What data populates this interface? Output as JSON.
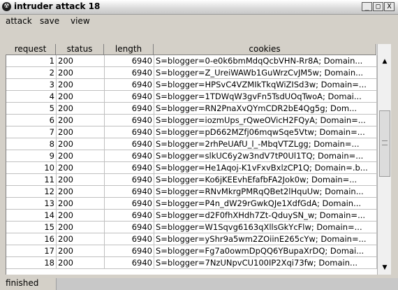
{
  "window": {
    "title": "intruder attack 18",
    "minimize": "_",
    "maximize": "□",
    "close": "X"
  },
  "menu": [
    "attack",
    "save",
    "view"
  ],
  "table": {
    "columns": [
      "request",
      "status",
      "length",
      "cookies"
    ],
    "rows": [
      [
        "1",
        "200",
        "6940",
        "S=blogger=0-e0k6bmMdqQcbVHN-Rr8A; Domain..."
      ],
      [
        "2",
        "200",
        "6940",
        "S=blogger=Z_UreiWAWb1GuWrzCvJM5w; Domain..."
      ],
      [
        "3",
        "200",
        "6940",
        "S=blogger=HPSvC4VZMIkTkqWiZISd3w; Domain=..."
      ],
      [
        "4",
        "200",
        "6940",
        "S=blogger=1TDWqW3gvFn5TsdUOqTwoA; Domai..."
      ],
      [
        "5",
        "200",
        "6940",
        "S=blogger=RN2PnaXvQYmCDR2bE4Qg5g; Dom..."
      ],
      [
        "6",
        "200",
        "6940",
        "S=blogger=iozmUps_rQweOVicH2FQyA; Domain=..."
      ],
      [
        "7",
        "200",
        "6940",
        "S=blogger=pD662MZfj06mqwSqe5Vtw; Domain=..."
      ],
      [
        "8",
        "200",
        "6940",
        "S=blogger=2rhPeUAfU_l_-MbqVTZLgg; Domain=..."
      ],
      [
        "9",
        "200",
        "6940",
        "S=blogger=slkUC6y2w3ndV7tP0Ul1TQ; Domain=..."
      ],
      [
        "10",
        "200",
        "6940",
        "S=blogger=He1Aqoj-K1vFxvBxlzCP1Q; Domain=.b..."
      ],
      [
        "11",
        "200",
        "6940",
        "S=blogger=Ko6jKEEvhEfafbFA2Jok0w; Domain=..."
      ],
      [
        "12",
        "200",
        "6940",
        "S=blogger=RNvMkrgPMRqQBet2lHquUw; Domain..."
      ],
      [
        "13",
        "200",
        "6940",
        "S=blogger=P4n_dW29rGwkQJe1XdfGdA; Domain..."
      ],
      [
        "14",
        "200",
        "6940",
        "S=blogger=d2F0fhXHdh7Zt-QduySN_w; Domain=..."
      ],
      [
        "15",
        "200",
        "6940",
        "S=blogger=W1Sqvg6163qXllsGkYcFlw; Domain=..."
      ],
      [
        "16",
        "200",
        "6940",
        "S=blogger=yShr9a5wm2ZOiinE265cYw; Domain=..."
      ],
      [
        "17",
        "200",
        "6940",
        "S=blogger=Fg7a0owmDpQQ6YBupaXrDQ; Domai..."
      ],
      [
        "18",
        "200",
        "6940",
        "S=blogger=7NzUNpvCU100IP2Xqi73fw; Domain..."
      ]
    ]
  },
  "scrollbar": {
    "up": "▲",
    "down": "▼"
  },
  "status": {
    "text": "finished"
  }
}
